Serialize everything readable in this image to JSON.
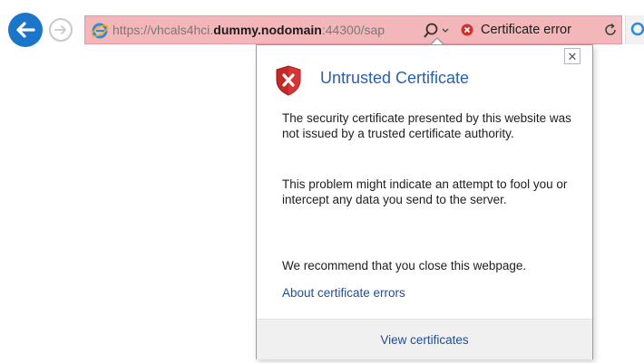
{
  "browser": {
    "address_bar": {
      "url_prefix": "https://vhcals4hci.",
      "url_host": "dummy.nodomain",
      "url_suffix": ":44300/sap",
      "certificate_error_label": "Certificate error",
      "background_color": "#f3b6b9"
    },
    "icons": {
      "back": "back-arrow-icon",
      "forward": "forward-arrow-icon",
      "site": "ie-logo-icon",
      "search": "search-icon",
      "cert_error": "error-x-icon",
      "refresh": "refresh-icon"
    }
  },
  "flyout": {
    "title": "Untrusted Certificate",
    "paragraph1": "The security certificate presented by this website was not issued by a trusted certificate authority.",
    "paragraph2": "This problem might indicate an attempt to fool you or intercept any data you send to the server.",
    "recommendation": "We recommend that you close this webpage.",
    "about_link": "About certificate errors",
    "view_certificates": "View certificates",
    "close_glyph": "✕",
    "title_color": "#2b5fa8",
    "link_color": "#1f4d9b"
  }
}
